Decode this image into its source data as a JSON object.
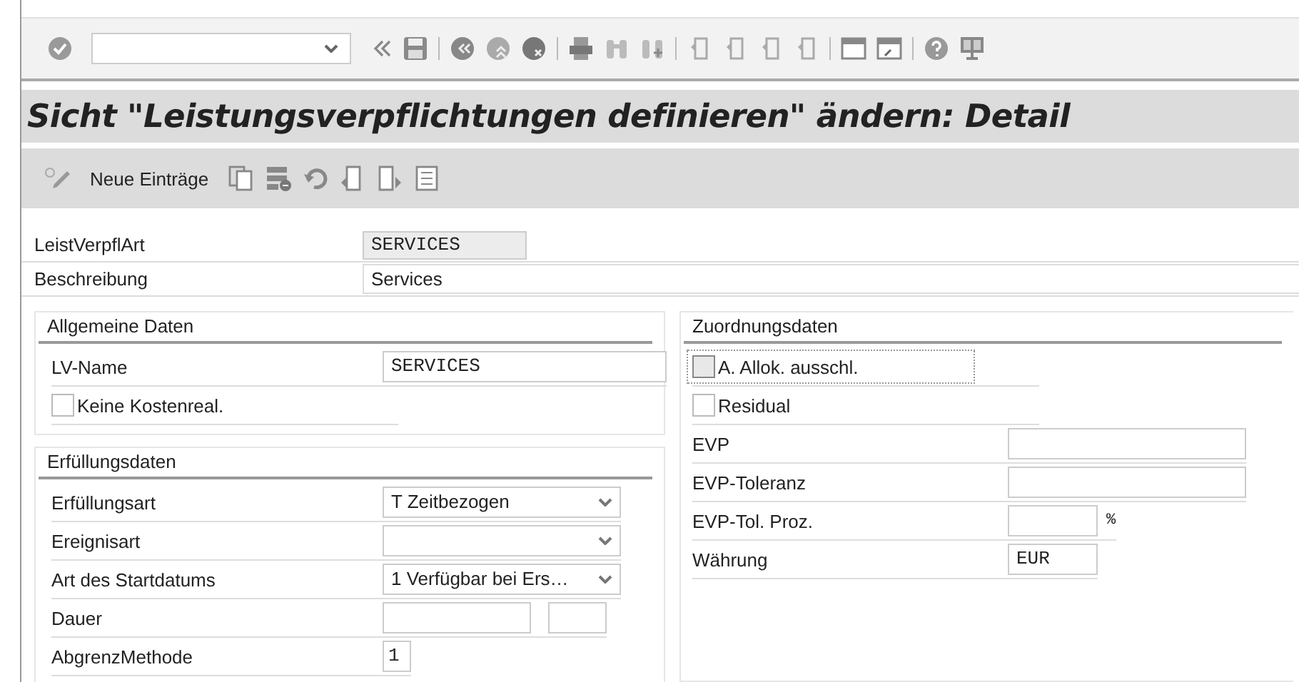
{
  "title": "Sicht \"Leistungsverpflichtungen definieren\" ändern: Detail",
  "app_toolbar": {
    "new_entries": "Neue Einträge"
  },
  "header_fields": [
    {
      "label": "LeistVerpflArt",
      "value": "SERVICES",
      "kind": "display"
    },
    {
      "label": "Beschreibung",
      "value": "Services",
      "kind": "wide"
    }
  ],
  "left_groups": [
    {
      "title": "Allgemeine Daten",
      "rows": [
        {
          "kind": "mono",
          "label": "LV-Name",
          "value": "SERVICES"
        },
        {
          "kind": "checkbox",
          "label": "Keine Kostenreal.",
          "checked": false,
          "focused": false
        }
      ]
    },
    {
      "title": "Erfüllungsdaten",
      "rows": [
        {
          "kind": "combo",
          "label": "Erfüllungsart",
          "value": "T Zeitbezogen"
        },
        {
          "kind": "combo",
          "label": "Ereignisart"
        },
        {
          "kind": "combo",
          "label": "Art des Startdatums",
          "value": "1 Verfügbar bei Ers…"
        },
        {
          "kind": "pair",
          "label": "Dauer"
        },
        {
          "kind": "tiny",
          "label": "AbgrenzMethode",
          "value": "1"
        }
      ]
    }
  ],
  "right_group": {
    "title": "Zuordnungsdaten",
    "rows": [
      {
        "kind": "checkbox",
        "label": "A. Allok. ausschl.",
        "checked": false,
        "focused": true
      },
      {
        "kind": "checkbox",
        "label": "Residual",
        "checked": false,
        "focused": false
      },
      {
        "kind": "field",
        "label": "EVP"
      },
      {
        "kind": "field",
        "label": "EVP-Toleranz"
      },
      {
        "kind": "short",
        "label": "EVP-Tol. Proz.",
        "unit": "%"
      },
      {
        "kind": "short",
        "label": "Währung",
        "value": "EUR"
      }
    ]
  }
}
